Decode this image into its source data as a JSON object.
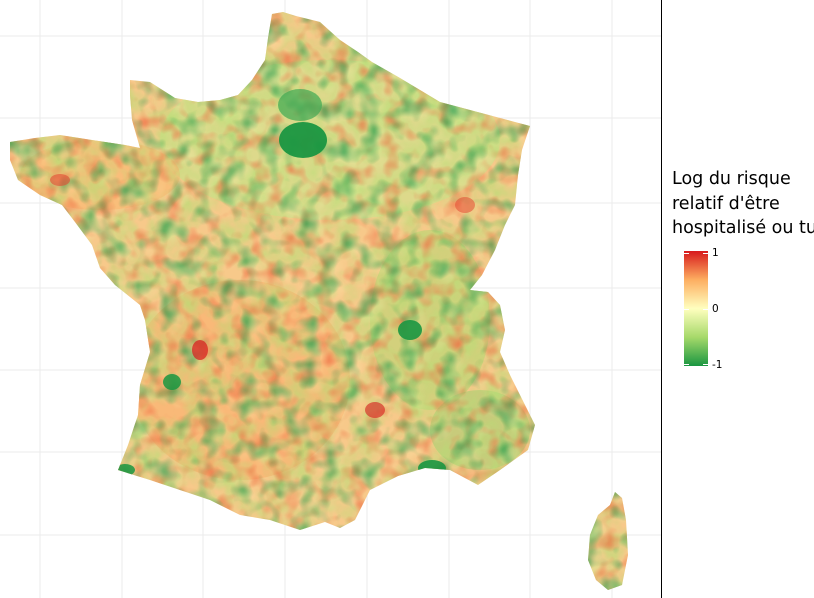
{
  "legend": {
    "title_lines": [
      "Log du risque",
      "relatif d'être",
      "hospitalisé ou tué"
    ],
    "min_label": "-1",
    "mid_label": "0",
    "max_label": "1",
    "colors": [
      "#1a9641",
      "#a6d96a",
      "#ffffbf",
      "#fdae61",
      "#d7191c"
    ],
    "range": [
      -1,
      1
    ]
  },
  "map": {
    "regions": [
      "France métropolitaine",
      "Corse"
    ],
    "grid": true,
    "grid_color": "#ebebeb",
    "background": "#ffffff"
  }
}
